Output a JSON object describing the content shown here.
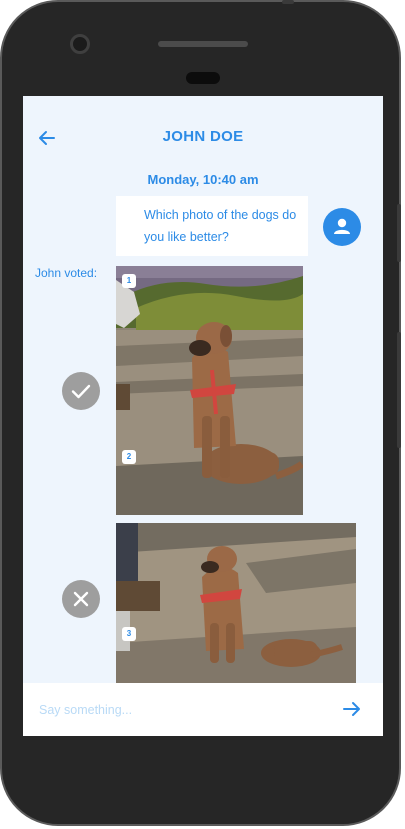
{
  "header": {
    "title": "JOHN DOE"
  },
  "chat": {
    "date": "Monday, 10:40 am",
    "message": "Which photo of the dogs do you like better?",
    "voted_label": "John voted:",
    "photos": [
      {
        "badges": [
          "1",
          "2"
        ],
        "vote": "check-icon"
      },
      {
        "badges": [
          "3"
        ],
        "vote": "close-icon"
      }
    ]
  },
  "composer": {
    "placeholder": "Say something..."
  },
  "colors": {
    "accent": "#2c8be6",
    "screen_bg": "#eef5fd",
    "vote_mark": "#9e9e9e"
  }
}
